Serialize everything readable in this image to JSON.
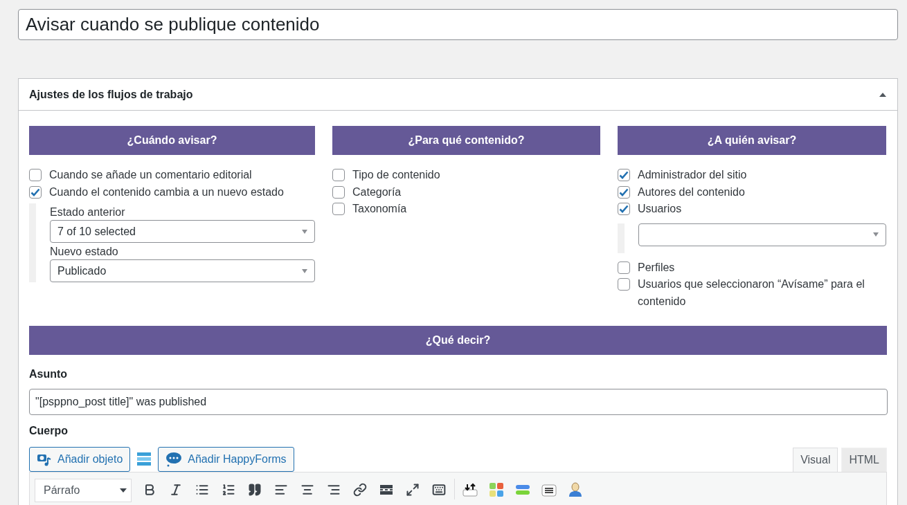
{
  "title_field": {
    "value": "Avisar cuando se publique contenido"
  },
  "panel": {
    "title": "Ajustes de los flujos de trabajo",
    "expanded": true
  },
  "when": {
    "heading": "¿Cuándo avisar?",
    "options": [
      {
        "label": "Cuando se añade un comentario editorial",
        "checked": false
      },
      {
        "label": "Cuando el contenido cambia a un nuevo estado",
        "checked": true
      }
    ],
    "previous_status": {
      "label": "Estado anterior",
      "value": "7 of 10 selected"
    },
    "new_status": {
      "label": "Nuevo estado",
      "value": "Publicado"
    }
  },
  "content": {
    "heading": "¿Para qué contenido?",
    "options": [
      {
        "label": "Tipo de contenido",
        "checked": false
      },
      {
        "label": "Categoría",
        "checked": false
      },
      {
        "label": "Taxonomía",
        "checked": false
      }
    ]
  },
  "recipients": {
    "heading": "¿A quién avisar?",
    "options": [
      {
        "kind": "checkbox",
        "label": "Administrador del sitio",
        "checked": true
      },
      {
        "kind": "checkbox",
        "label": "Autores del contenido",
        "checked": true
      },
      {
        "kind": "checkbox",
        "label": "Usuarios",
        "checked": true
      },
      {
        "kind": "select"
      },
      {
        "kind": "checkbox",
        "label": "Perfiles",
        "checked": false
      },
      {
        "kind": "checkbox",
        "label": "Usuarios que seleccionaron “Avísame” para el contenido",
        "checked": false
      }
    ]
  },
  "message": {
    "heading": "¿Qué decir?",
    "subject_label": "Asunto",
    "subject_value": "\"[psppno_post title]\" was published",
    "body_label": "Cuerpo",
    "buttons": [
      {
        "kind": "media",
        "label": "Añadir objeto"
      },
      {
        "kind": "forms",
        "label": "Añadir HappyForms"
      }
    ],
    "editor_tabs": [
      {
        "label": "Visual",
        "selected": true
      },
      {
        "label": "HTML",
        "selected": false
      }
    ],
    "format_select": "Párrafo"
  }
}
